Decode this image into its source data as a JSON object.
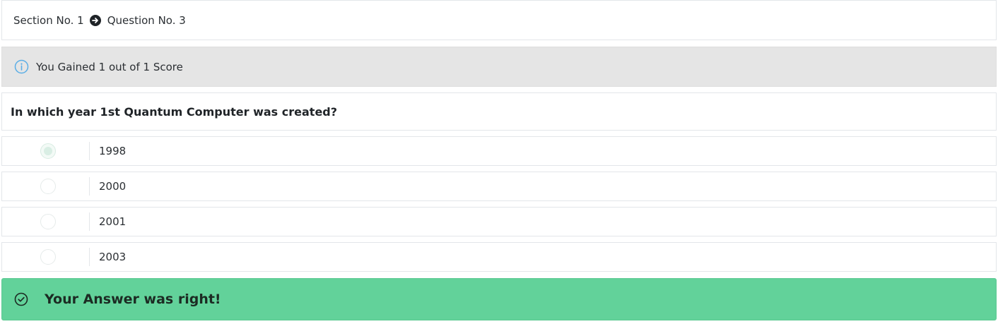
{
  "breadcrumb": {
    "section": "Section No. 1",
    "separator_icon": "arrow-circle-right-icon",
    "question": "Question No. 3"
  },
  "score_alert": {
    "icon": "info-circle-icon",
    "text": "You Gained 1 out of 1 Score",
    "accent_color": "#5aaee6"
  },
  "question": {
    "text": "In which year 1st Quantum Computer was created?"
  },
  "options": [
    {
      "label": "1998",
      "selected": true
    },
    {
      "label": "2000",
      "selected": false
    },
    {
      "label": "2001",
      "selected": false
    },
    {
      "label": "2003",
      "selected": false
    }
  ],
  "result_alert": {
    "icon": "check-circle-icon",
    "text": "Your Answer was right!",
    "background_color": "#62d29a"
  }
}
